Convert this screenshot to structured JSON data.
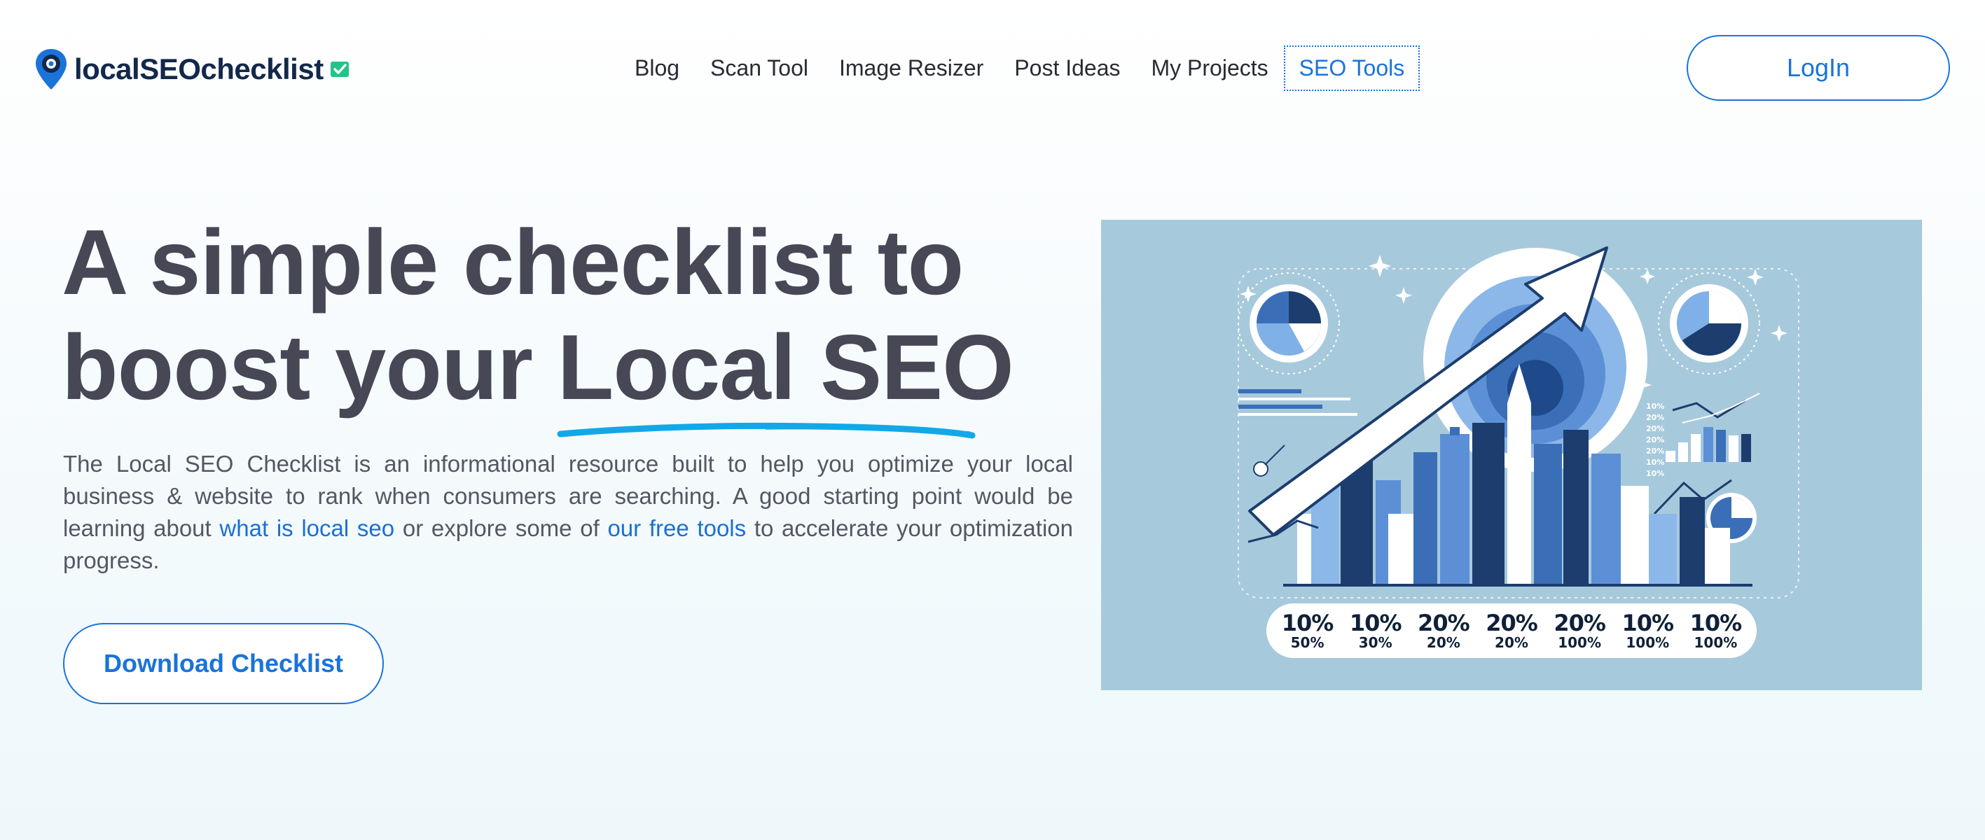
{
  "header": {
    "logo_text": "localSEOchecklist",
    "nav": [
      {
        "label": "Blog"
      },
      {
        "label": "Scan Tool"
      },
      {
        "label": "Image Resizer"
      },
      {
        "label": "Post Ideas"
      },
      {
        "label": "My Projects"
      },
      {
        "label": "SEO Tools",
        "active": true
      }
    ],
    "login_label": "LogIn"
  },
  "hero": {
    "title_line1": "A simple checklist to",
    "title_line2_prefix": "boost your ",
    "title_highlight": "Local SEO",
    "description": {
      "part1": "The Local SEO Checklist is an informational resource built to help you optimize your local business & website to rank when consumers are searching. A good starting point would be learning about ",
      "link1": "what is local seo",
      "part2": " or explore some of ",
      "link2": "our free tools",
      "part3": " to accelerate your optimization progress."
    },
    "cta_label": "Download Checklist"
  },
  "illustration": {
    "percent_labels": [
      {
        "top": "10%",
        "bottom": "50%"
      },
      {
        "top": "10%",
        "bottom": "30%"
      },
      {
        "top": "20%",
        "bottom": "20%"
      },
      {
        "top": "20%",
        "bottom": "20%"
      },
      {
        "top": "20%",
        "bottom": "100%"
      },
      {
        "top": "10%",
        "bottom": "100%"
      },
      {
        "top": "10%",
        "bottom": "100%"
      }
    ],
    "side_labels": [
      "10%",
      "20%",
      "20%",
      "20%",
      "20%",
      "10%",
      "10%"
    ]
  },
  "colors": {
    "accent": "#1a73d9",
    "title": "#474756",
    "underline": "#12a8e8",
    "illustration_bg": "#a7c9dc",
    "navy": "#102038"
  }
}
